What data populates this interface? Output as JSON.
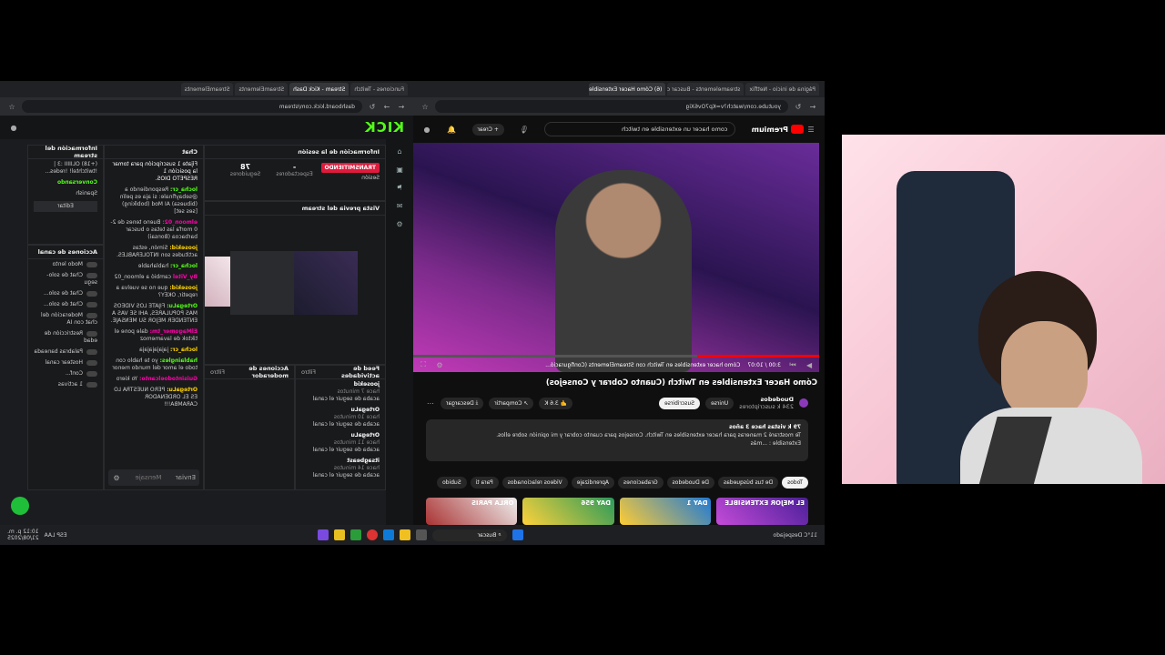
{
  "left_browser": {
    "tabs": [
      "Funciones - Twitch",
      "Stream - Kick Dash",
      "StreamElements",
      "StreamElements"
    ],
    "url": "dashboard.kick.com/stream",
    "logo": "KICK"
  },
  "kick": {
    "session_panel": {
      "title": "Información de la sesión",
      "live_badge": "TRANSMITIENDO",
      "session_label": "Sesión",
      "viewers_label": "Espectadores",
      "viewers_value": "-",
      "followers_label": "Seguidores",
      "followers_value": "78"
    },
    "preview_panel": {
      "title": "Vista previa del stream"
    },
    "chat_panel": {
      "title": "Chat",
      "pinned": "Fíjate 1 suscripción para tomar la posición 1",
      "pinned_sub": "RESPETO DIOS.",
      "messages": [
        {
          "user": "locha_cr:",
          "text": "Respondiendo a @sebayfinale: si aja es pelín (bibuesa) AI Mod (bobíking) [ses set]"
        },
        {
          "user": "elmoon_02:",
          "text": "Bueno tenes de 2-0 morfa las tetas o buscar barbacoa (Bonsai)"
        },
        {
          "user": "joosekid:",
          "text": "Simón, estas actitudes son INTOLERABLES."
        },
        {
          "user": "locha_cr:",
          "text": "hablahable"
        },
        {
          "user": "By_Vitel",
          "text": "cambió a elmoon_02"
        },
        {
          "user": "joosekid:",
          "text": "que no se vuelva a repetir, OKEY?"
        },
        {
          "user": "OrtegaLu:",
          "text": "FIJATE LOS VIDEOS MAS POPULARES, AHI SE VAS A ENTENDER MEJOR SU MENSAJE."
        },
        {
          "user": "ElMagomer_tm:",
          "text": "dale pone el tiktok de lavamemoz"
        },
        {
          "user": "locha_cr:",
          "text": "jajajajajaja"
        },
        {
          "user": "hablaingles:",
          "text": "yo te hablo con todo el amor del mundo menor"
        },
        {
          "user": "Guisintodoelcanto:",
          "text": "Yo kiero"
        },
        {
          "user": "OrtegaLu:",
          "text": "PERO NUESTRA LO ES EL ORDENADOR CARAMBA!!!"
        }
      ],
      "send_label": "Enviar",
      "send_sub": "Mensaje"
    },
    "stream_info": {
      "title": "Información del stream",
      "line1": "(+18) OLIIIII :3 | !twitchtel! !redes...",
      "category": "Conversando",
      "lang": "Spanish",
      "edit_label": "Editar"
    },
    "channel_actions": {
      "title": "Acciones de canal",
      "items": [
        "Modo lento",
        "Chat de solo-segu",
        "Chat de solo...",
        "Chat de solo...",
        "Moderación del chat con IA",
        "Restricción de edad",
        "Palabras baneada",
        "Hostear canal",
        "Conf...",
        "1 activas"
      ]
    },
    "activity_panel": {
      "title": "Feed de actividades",
      "filter": "Filtro",
      "items": [
        {
          "user": "joosekid",
          "text": "acaba de seguir el canal",
          "time": "hace 7 minutos"
        },
        {
          "user": "OrtegaLu",
          "text": "acaba de seguir el canal",
          "time": "hace 10 minutos"
        },
        {
          "user": "OrtegaLu",
          "text": "acaba de seguir el canal",
          "time": "hace 11 minutos"
        },
        {
          "user": "itsagbeast",
          "text": "acaba de seguir el canal",
          "time": "hace 14 minutos"
        }
      ]
    },
    "mod_panel": {
      "title": "Acciones de moderador",
      "filter": "Filtro"
    }
  },
  "right_browser": {
    "tabs": [
      "Página de inicio - Netflix",
      "streamelements - Buscar con",
      "(6) Cómo Hacer Extensibles en"
    ],
    "url": "youtube.com/watch?v=Kp7Ov6Xig"
  },
  "youtube": {
    "logo": "Premium",
    "search": "como hacer un extensible en twitch",
    "create_label": "Crear",
    "time": "3:00 / 10:07",
    "chapter": "Cómo hacer extensibles en Twitch con StreamElements (Configuració...",
    "title": "Cómo Hacer Extensibles en Twitch (Cuanto Cobrar y Consejos)",
    "channel": "Duodedos",
    "subs": "234 k suscriptores",
    "join_label": "Unirse",
    "subscribe_label": "Suscribirse",
    "likes": "3.6 K",
    "share_label": "Compartir",
    "download_label": "Descargar",
    "description": {
      "meta": "79 k vistas  hace 3 años",
      "line1": "Te mostraré 2 maneras para hacer extensibles en Twitch. Consejos para cuanto cobrar y mi opinión sobre ellos.",
      "line2": "Extensible : ...más"
    },
    "chips": [
      "Todos",
      "De tus búsquedas",
      "De Duodedos",
      "Grabaciones",
      "Aprendizaje",
      "Videos relacionados",
      "Para ti",
      "Subido"
    ],
    "thumbs": [
      "EL MEJOR EXTENSIBLE",
      "DAY 1",
      "DAY 956",
      "ORLA PARIS"
    ]
  },
  "taskbar": {
    "search": "Buscar",
    "weather": "11°C Despejado",
    "clock_time": "10:12 p. m.",
    "clock_date": "21/08/2025",
    "lang": "ESP LAA"
  },
  "colors": {
    "kick_green": "#53fc18",
    "youtube_red": "#ff0000",
    "live_red": "#e01a3c"
  }
}
